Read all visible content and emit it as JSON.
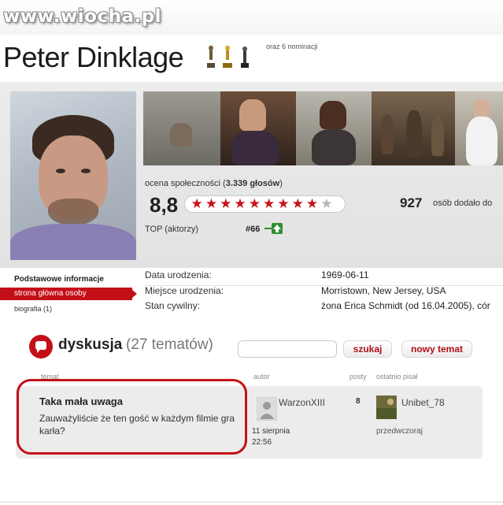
{
  "watermark": "www.wiocha.pl",
  "person": {
    "name": "Peter Dinklage",
    "nominations": "oraz 6 nominacji"
  },
  "rating": {
    "label_prefix": "ocena społeczności (",
    "votes": "3.339 głosów",
    "label_suffix": ")",
    "score": "8,8",
    "score_fraction": 0.88,
    "stars_filled": 9,
    "stars_total": 10,
    "favorites_count": "927",
    "favorites_text": "osób dodało do",
    "top_label": "TOP (aktorzy)",
    "top_rank": "#66"
  },
  "nav": {
    "title": "Podstawowe informacje",
    "active_item": "strona główna osoby",
    "bio_item": "biografia (1)"
  },
  "info": [
    {
      "label": "Data urodzenia:",
      "value": "1969-06-11"
    },
    {
      "label": "Miejsce urodzenia:",
      "value": "Morristown, New Jersey, USA"
    },
    {
      "label": "Stan cywilny:",
      "value": "żona Erica Schmidt (od 16.04.2005), cór"
    }
  ],
  "discussion": {
    "title": "dyskusja",
    "count": "(27 tematów)",
    "search_placeholder": "",
    "search_button": "szukaj",
    "new_topic_button": "nowy temat",
    "columns": {
      "topic": "temat",
      "author": "autor",
      "posts": "posty",
      "last_post": "ostatnio pisał"
    },
    "threads": [
      {
        "title": "Taka mała uwaga",
        "text": "Zauważyliście że ten gość w każdym filmie gra karła?",
        "author": "WarzonXIII",
        "date": "11 sierpnia",
        "time": "22:56",
        "posts": "8",
        "last_author": "Unibet_78",
        "last_time": "przedwczoraj"
      }
    ]
  },
  "colors": {
    "accent": "#c40f18",
    "star_on": "#c7121b",
    "star_off": "#b5b5b5",
    "panel": "#ececec"
  },
  "icons": [
    "award-statuette-icon",
    "discussion-bubble-icon",
    "rank-up-arrow-icon",
    "star-icon",
    "avatar-icon"
  ]
}
